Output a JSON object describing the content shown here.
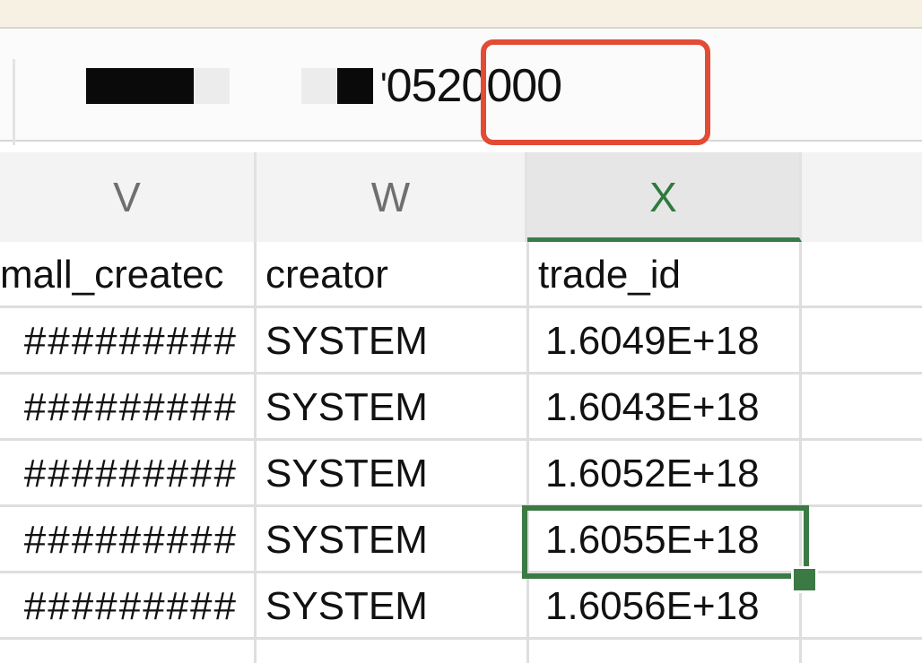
{
  "formula_bar": {
    "value_text": "0520000",
    "partial_glyph": "'"
  },
  "columns": [
    {
      "letter": "V",
      "selected": false
    },
    {
      "letter": "W",
      "selected": false
    },
    {
      "letter": "X",
      "selected": true
    }
  ],
  "headers": {
    "v": "mall_createc",
    "w": "creator",
    "x": "trade_id"
  },
  "rows": [
    {
      "v": "#########",
      "w": "SYSTEM",
      "x": "1.6049E+18"
    },
    {
      "v": "#########",
      "w": "SYSTEM",
      "x": "1.6043E+18"
    },
    {
      "v": "#########",
      "w": "SYSTEM",
      "x": "1.6052E+18"
    },
    {
      "v": "#########",
      "w": "SYSTEM",
      "x": "1.6055E+18"
    },
    {
      "v": "#########",
      "w": "SYSTEM",
      "x": "1.6056E+18"
    }
  ],
  "colors": {
    "accent_green": "#3c7a45",
    "highlight_red": "#e24b34"
  }
}
